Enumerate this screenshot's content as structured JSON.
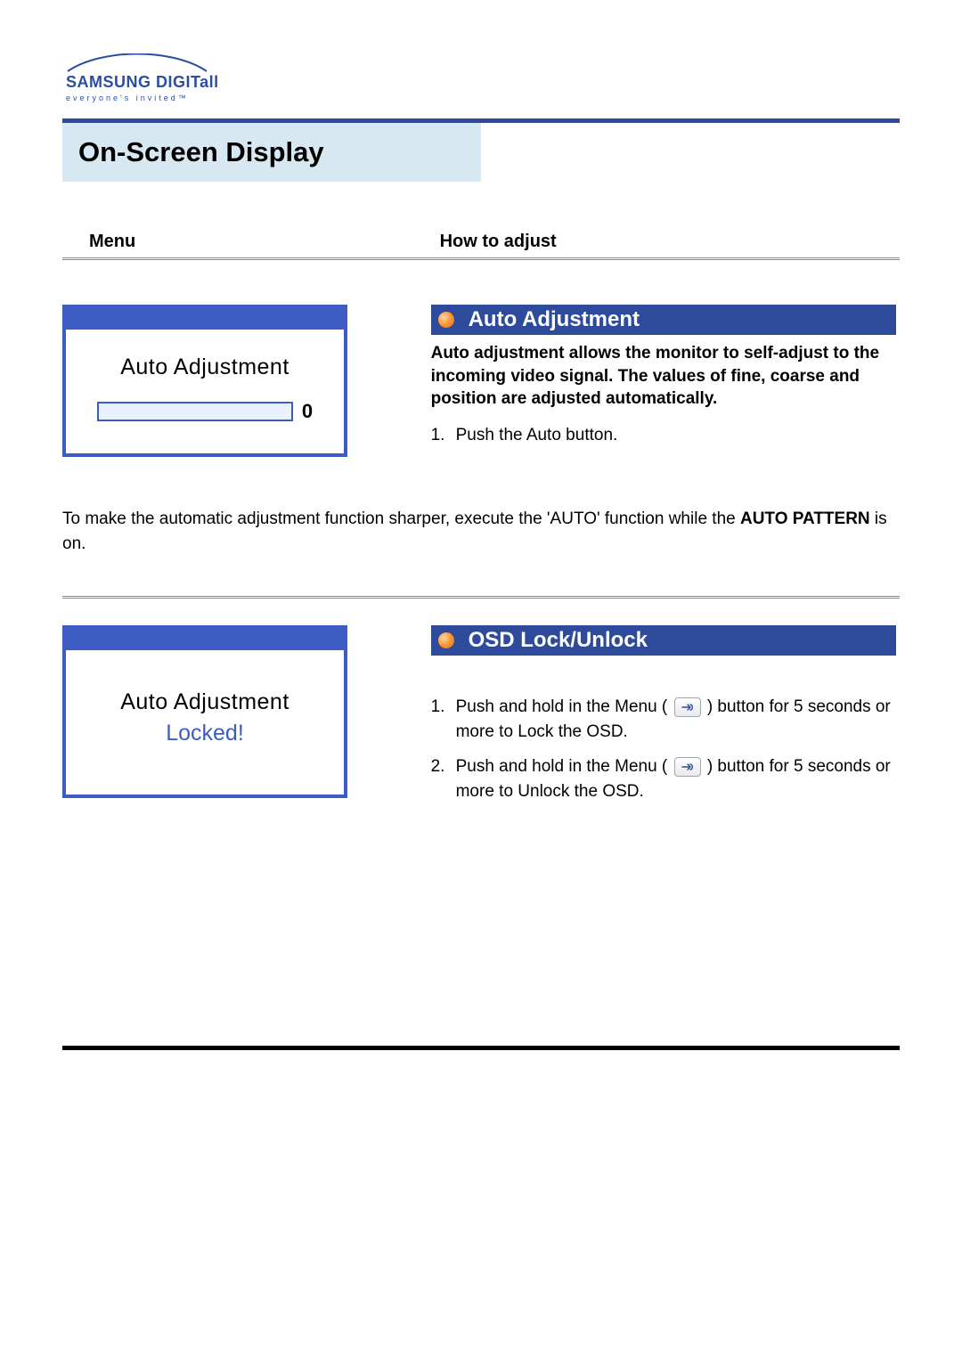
{
  "brand": {
    "line1a": "SAMSUNG DIGIT",
    "line1b": "all",
    "tagline": "everyone's invited™"
  },
  "pageTitle": "On-Screen Display",
  "columns": {
    "menu": "Menu",
    "howto": "How to adjust"
  },
  "section1": {
    "osd": {
      "title": "Auto Adjustment",
      "progressVal": "0"
    },
    "label": "Auto Adjustment",
    "desc": "Auto adjustment allows the monitor to self-adjust to the incoming video signal. The values of fine, coarse and position are adjusted automatically.",
    "steps": [
      {
        "n": "1.",
        "text": "Push the Auto button."
      }
    ]
  },
  "midNote": {
    "pre": "To make the automatic adjustment function sharper, execute the 'AUTO' function while the ",
    "strong": "AUTO PATTERN",
    "post": " is on."
  },
  "section2": {
    "osd": {
      "title": "Auto Adjustment",
      "locked": "Locked!"
    },
    "label": "OSD Lock/Unlock",
    "steps": [
      {
        "n": "1.",
        "pre": "Push and hold in the Menu ( ",
        "post": " ) button for 5 seconds or more to Lock the OSD."
      },
      {
        "n": "2.",
        "pre": "Push and hold in the Menu ( ",
        "post": " ) button for 5 seconds or more to Unlock the OSD."
      }
    ]
  }
}
